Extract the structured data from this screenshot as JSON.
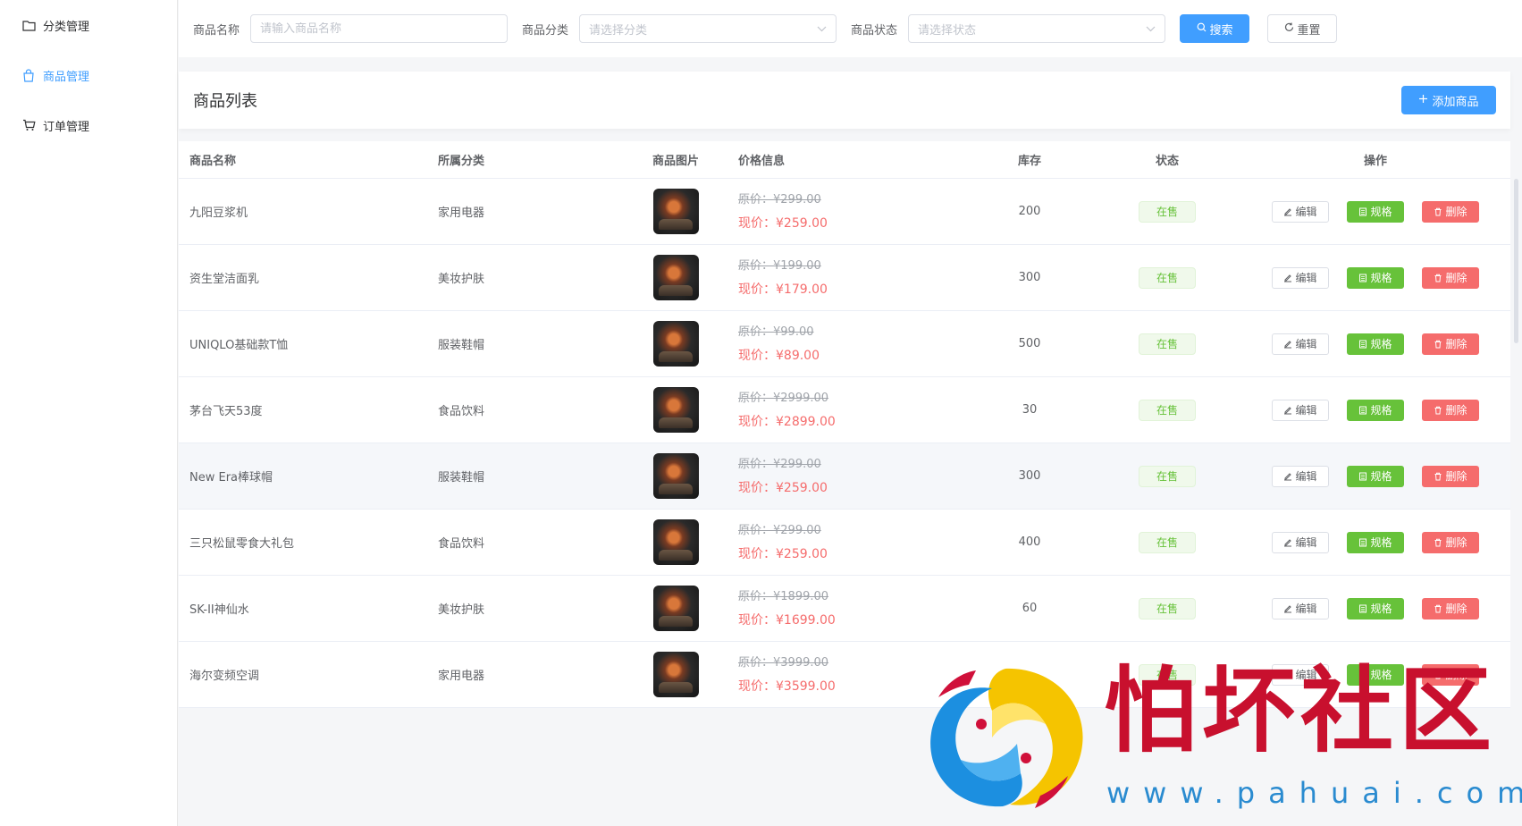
{
  "sidebar": {
    "items": [
      {
        "label": "分类管理",
        "icon": "folder-icon"
      },
      {
        "label": "商品管理",
        "icon": "bag-icon"
      },
      {
        "label": "订单管理",
        "icon": "cart-icon"
      }
    ],
    "active_color": "#409eff"
  },
  "filter": {
    "name_label": "商品名称",
    "name_placeholder": "请输入商品名称",
    "category_label": "商品分类",
    "category_placeholder": "请选择分类",
    "status_label": "商品状态",
    "status_placeholder": "请选择状态",
    "search_label": "搜索",
    "reset_label": "重置"
  },
  "list": {
    "title": "商品列表",
    "add_label": "添加商品"
  },
  "table": {
    "headers": {
      "name": "商品名称",
      "category": "所属分类",
      "image": "商品图片",
      "price": "价格信息",
      "stock": "库存",
      "status": "状态",
      "ops": "操作"
    },
    "op_labels": {
      "edit": "编辑",
      "spec": "规格",
      "delete": "删除"
    },
    "rows": [
      {
        "name": "九阳豆浆机",
        "category": "家用电器",
        "old_price": "原价：¥299.00",
        "new_price": "现价：¥259.00",
        "stock": "200",
        "status": "在售"
      },
      {
        "name": "资生堂洁面乳",
        "category": "美妆护肤",
        "old_price": "原价：¥199.00",
        "new_price": "现价：¥179.00",
        "stock": "300",
        "status": "在售"
      },
      {
        "name": "UNIQLO基础款T恤",
        "category": "服装鞋帽",
        "old_price": "原价：¥99.00",
        "new_price": "现价：¥89.00",
        "stock": "500",
        "status": "在售"
      },
      {
        "name": "茅台飞天53度",
        "category": "食品饮料",
        "old_price": "原价：¥2999.00",
        "new_price": "现价：¥2899.00",
        "stock": "30",
        "status": "在售"
      },
      {
        "name": "New Era棒球帽",
        "category": "服装鞋帽",
        "old_price": "原价：¥299.00",
        "new_price": "现价：¥259.00",
        "stock": "300",
        "status": "在售"
      },
      {
        "name": "三只松鼠零食大礼包",
        "category": "食品饮料",
        "old_price": "原价：¥299.00",
        "new_price": "现价：¥259.00",
        "stock": "400",
        "status": "在售"
      },
      {
        "name": "SK-II神仙水",
        "category": "美妆护肤",
        "old_price": "原价：¥1899.00",
        "new_price": "现价：¥1699.00",
        "stock": "60",
        "status": "在售"
      },
      {
        "name": "海尔变频空调",
        "category": "家用电器",
        "old_price": "原价：¥3999.00",
        "new_price": "现价：¥3599.00",
        "stock": "",
        "status": "在售"
      }
    ]
  },
  "watermark": {
    "text": "怕坏社区",
    "url": "www.pahuai.com"
  }
}
